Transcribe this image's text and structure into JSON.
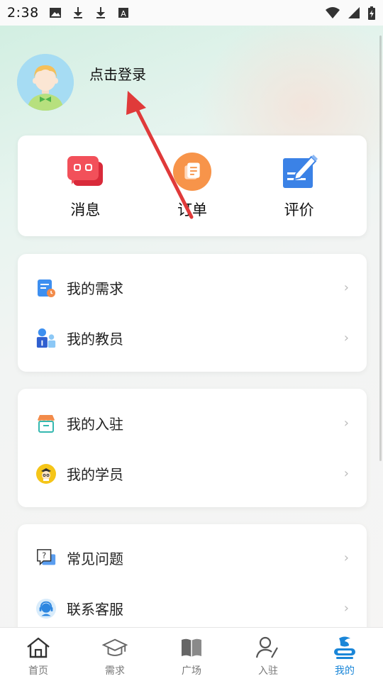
{
  "status_bar": {
    "time": "2:38",
    "icons": [
      "image-icon",
      "download-icon",
      "download-icon",
      "font-icon"
    ],
    "right_icons": [
      "wifi-icon",
      "cell-signal-icon",
      "battery-charging-icon"
    ]
  },
  "profile": {
    "login_label": "点击登录"
  },
  "quick_actions": [
    {
      "label": "消息",
      "icon": "message-icon",
      "color": "#f0434f"
    },
    {
      "label": "订单",
      "icon": "order-icon",
      "color": "#f7944a"
    },
    {
      "label": "评价",
      "icon": "edit-review-icon",
      "color": "#3b82e6"
    }
  ],
  "menu_group_1": [
    {
      "label": "我的需求",
      "icon": "request-icon"
    },
    {
      "label": "我的教员",
      "icon": "teacher-icon"
    }
  ],
  "menu_group_2": [
    {
      "label": "我的入驻",
      "icon": "store-icon"
    },
    {
      "label": "我的学员",
      "icon": "student-icon"
    }
  ],
  "menu_group_3": [
    {
      "label": "常见问题",
      "icon": "faq-icon"
    },
    {
      "label": "联系客服",
      "icon": "customer-service-icon"
    }
  ],
  "chevron": "›",
  "bottom_nav": [
    {
      "label": "首页",
      "icon": "home-icon",
      "active": false
    },
    {
      "label": "需求",
      "icon": "graduation-cap-icon",
      "active": false
    },
    {
      "label": "广场",
      "icon": "book-icon",
      "active": false
    },
    {
      "label": "入驻",
      "icon": "person-edit-icon",
      "active": false
    },
    {
      "label": "我的",
      "icon": "profile-icon",
      "active": true
    }
  ],
  "colors": {
    "accent": "#1a86d8",
    "annotation_arrow": "#e03a3a"
  }
}
